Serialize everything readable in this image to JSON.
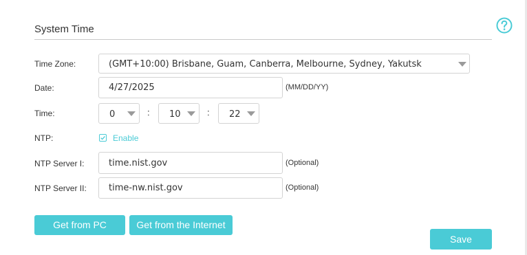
{
  "section_title": "System Time",
  "help_icon": "question-circle-icon",
  "accent_color": "#4acbd6",
  "time_zone": {
    "label": "Time Zone:",
    "value": "(GMT+10:00) Brisbane, Guam, Canberra, Melbourne, Sydney, Yakutsk"
  },
  "date": {
    "label": "Date:",
    "value": "4/27/2025",
    "format_hint": "(MM/DD/YY)"
  },
  "time": {
    "label": "Time:",
    "hour": "0",
    "minute": "10",
    "second": "22",
    "separator": ":"
  },
  "ntp": {
    "label": "NTP:",
    "enable_label": "Enable",
    "enabled": true
  },
  "ntp_server_1": {
    "label": "NTP Server I:",
    "value": "time.nist.gov",
    "hint": "(Optional)"
  },
  "ntp_server_2": {
    "label": "NTP Server II:",
    "value": "time-nw.nist.gov",
    "hint": "(Optional)"
  },
  "buttons": {
    "get_from_pc": "Get from PC",
    "get_from_internet": "Get from the Internet",
    "save": "Save"
  }
}
